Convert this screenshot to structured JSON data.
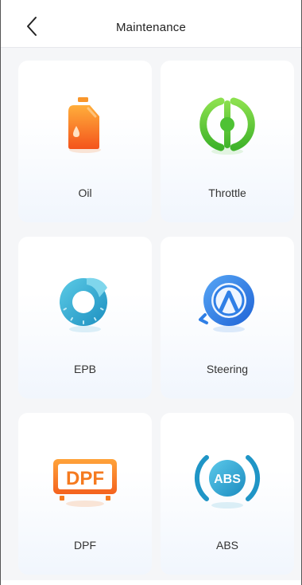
{
  "header": {
    "title": "Maintenance",
    "back_icon": "chevron-left-icon"
  },
  "colors": {
    "oil": "#f57a1f",
    "throttle": "#5cc93a",
    "epb": "#2ba3cf",
    "steering": "#2f7fe6",
    "dpf": "#f57a1f",
    "abs": "#2aa1c8"
  },
  "items": [
    {
      "label": "Oil",
      "icon": "oil-can-icon"
    },
    {
      "label": "Throttle",
      "icon": "throttle-icon"
    },
    {
      "label": "EPB",
      "icon": "brake-disc-icon"
    },
    {
      "label": "Steering",
      "icon": "steering-icon"
    },
    {
      "label": "DPF",
      "icon": "dpf-icon",
      "icon_text": "DPF"
    },
    {
      "label": "ABS",
      "icon": "abs-icon",
      "icon_text": "ABS"
    }
  ]
}
